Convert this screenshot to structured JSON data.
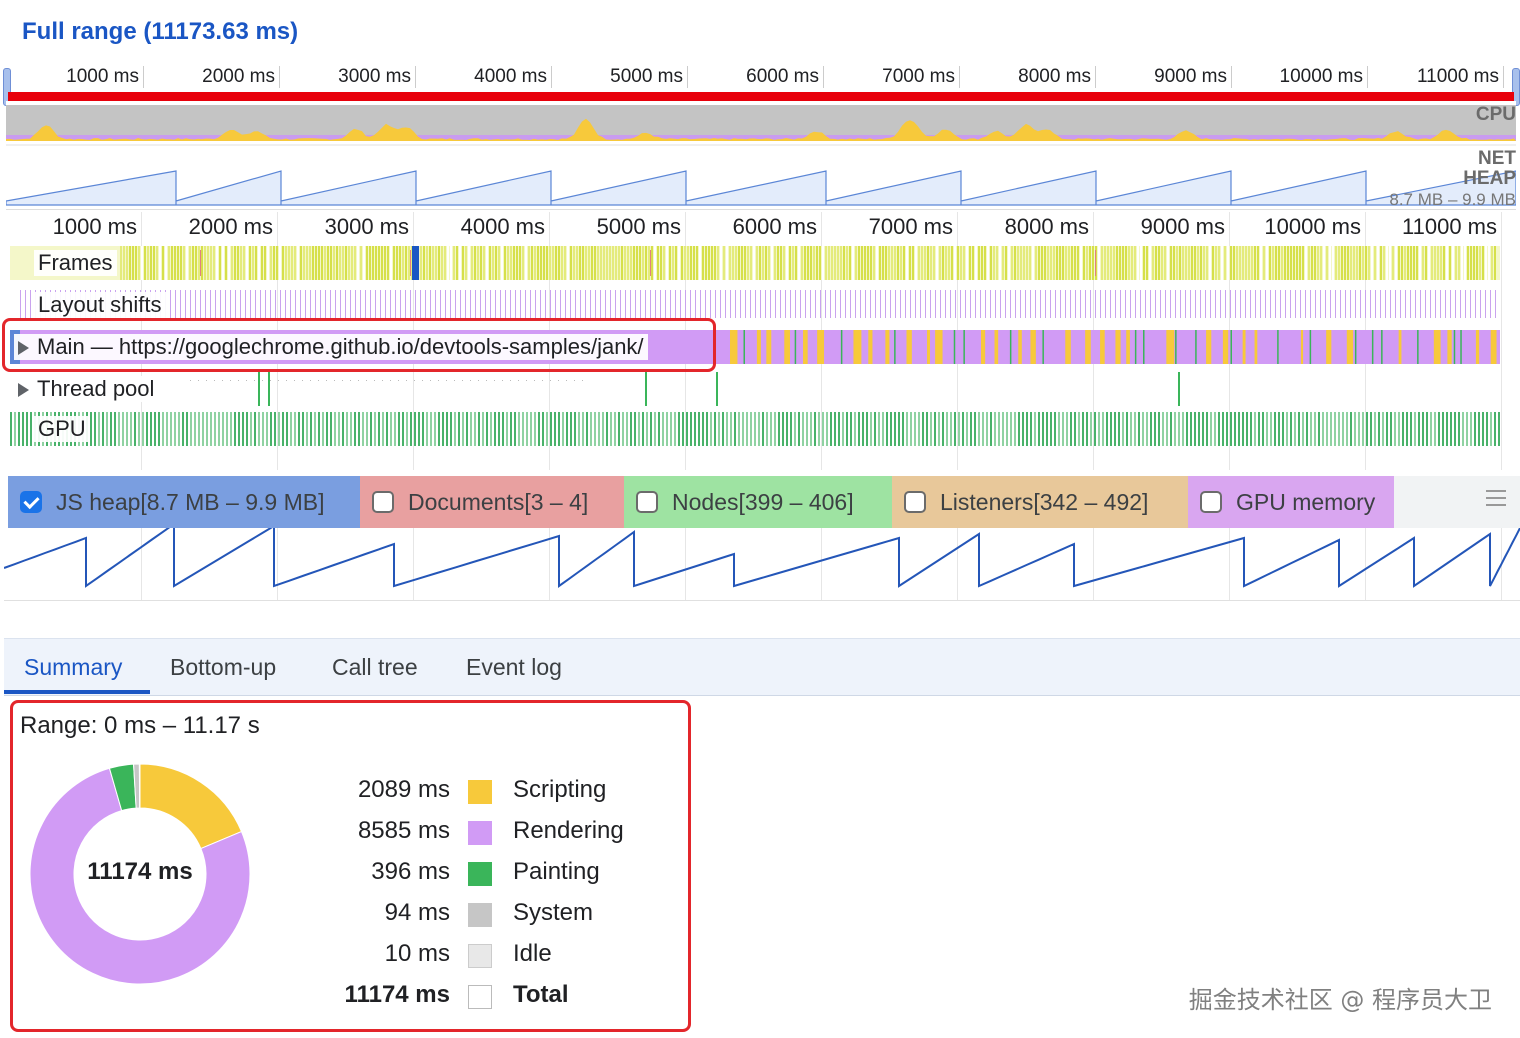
{
  "header": {
    "full_range": "Full range (11173.63 ms)"
  },
  "overview_ruler": {
    "ticks": [
      "1000 ms",
      "2000 ms",
      "3000 ms",
      "4000 ms",
      "5000 ms",
      "6000 ms",
      "7000 ms",
      "8000 ms",
      "9000 ms",
      "10000 ms",
      "11000 ms"
    ]
  },
  "overview_labels": {
    "cpu": "CPU",
    "net": "NET",
    "heap": "HEAP",
    "heap_range": "8.7 MB – 9.9 MB"
  },
  "main_ruler": {
    "ticks": [
      "1000 ms",
      "2000 ms",
      "3000 ms",
      "4000 ms",
      "5000 ms",
      "6000 ms",
      "7000 ms",
      "8000 ms",
      "9000 ms",
      "10000 ms",
      "11000 ms"
    ]
  },
  "tracks": {
    "frames": "Frames",
    "layout_shifts": "Layout shifts",
    "main": "Main — https://googlechrome.github.io/devtools-samples/jank/",
    "thread_pool": "Thread pool",
    "gpu": "GPU"
  },
  "counters": [
    {
      "label": "JS heap[8.7 MB – 9.9 MB]",
      "checked": true,
      "color": "#7a9ee0"
    },
    {
      "label": "Documents[3 – 4]",
      "checked": false,
      "color": "#e8a0a0"
    },
    {
      "label": "Nodes[399 – 406]",
      "checked": false,
      "color": "#9ee3a2"
    },
    {
      "label": "Listeners[342 – 492]",
      "checked": false,
      "color": "#e8c89a"
    },
    {
      "label": "GPU memory",
      "checked": false,
      "color": "#d9a6f0"
    }
  ],
  "tabs": [
    {
      "label": "Summary",
      "active": true
    },
    {
      "label": "Bottom-up",
      "active": false
    },
    {
      "label": "Call tree",
      "active": false
    },
    {
      "label": "Event log",
      "active": false
    }
  ],
  "summary": {
    "range": "Range: 0 ms – 11.17 s",
    "total_center": "11174 ms",
    "items": [
      {
        "value": "2089 ms",
        "name": "Scripting",
        "color": "#f7c93b",
        "ms": 2089
      },
      {
        "value": "8585 ms",
        "name": "Rendering",
        "color": "#d19bf5",
        "ms": 8585
      },
      {
        "value": "396 ms",
        "name": "Painting",
        "color": "#3ab55a",
        "ms": 396
      },
      {
        "value": "94 ms",
        "name": "System",
        "color": "#c6c6c6",
        "ms": 94
      },
      {
        "value": "10 ms",
        "name": "Idle",
        "color": "#e8e8e8",
        "ms": 10
      },
      {
        "value": "11174 ms",
        "name": "Total",
        "color": "#ffffff",
        "ms": 11174,
        "bold": true
      }
    ]
  },
  "watermark": "掘金技术社区 @ 程序员大卫"
}
